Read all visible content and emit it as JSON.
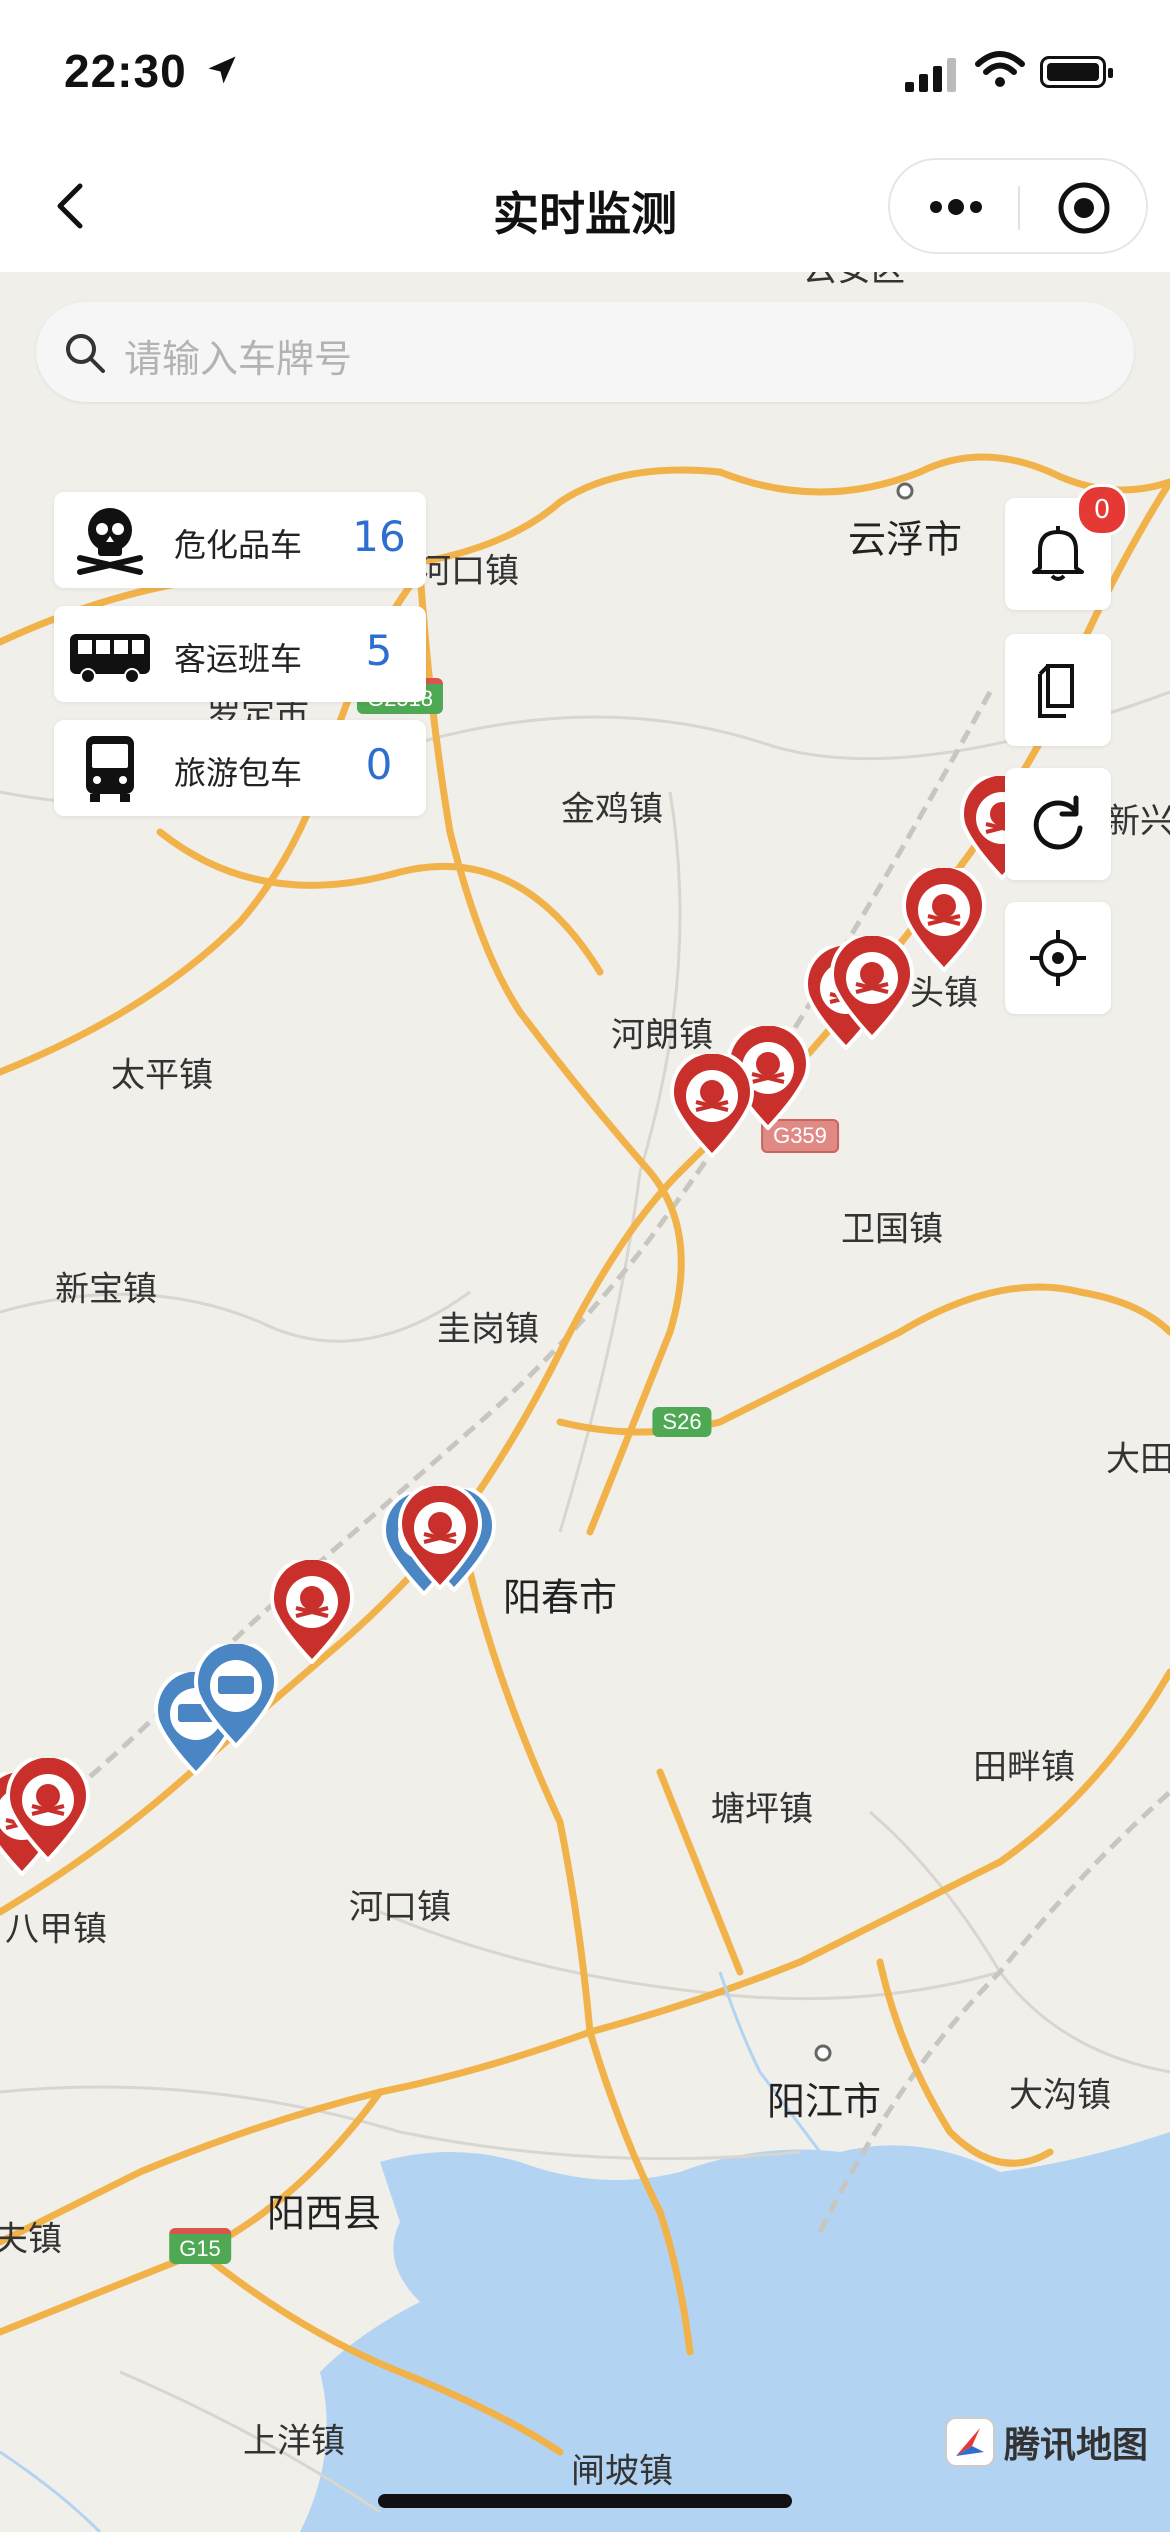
{
  "status_bar": {
    "time": "22:30"
  },
  "nav": {
    "title": "实时监测"
  },
  "search": {
    "placeholder": "请输入车牌号"
  },
  "legend": [
    {
      "label": "危化品车",
      "count": "16",
      "icon": "skull-crossbones-icon"
    },
    {
      "label": "客运班车",
      "count": "5",
      "icon": "coach-bus-icon"
    },
    {
      "label": "旅游包车",
      "count": "0",
      "icon": "tour-bus-icon"
    }
  ],
  "notifications": {
    "badge": "0"
  },
  "map": {
    "places": [
      "云浮市",
      "河口镇",
      "金鸡镇",
      "河朗镇",
      "太平镇",
      "卫国镇",
      "新宝镇",
      "圭岗镇",
      "阳春市",
      "田畔镇",
      "塘坪镇",
      "河口镇",
      "八甲镇",
      "阳江市",
      "大沟镇",
      "阳西县",
      "夫镇",
      "上洋镇",
      "闸坡镇",
      "新兴",
      "大田",
      "罗定市",
      "云安区",
      "头镇"
    ],
    "road_shields": [
      "G2518",
      "G359",
      "S26",
      "G15"
    ],
    "brand": "腾讯地图"
  },
  "colors": {
    "accent": "#2c6fd0",
    "hazmat_marker": "#c9302c",
    "bus_marker": "#4a86c4",
    "road": "#f2b24a",
    "water": "#b3d3f2"
  }
}
